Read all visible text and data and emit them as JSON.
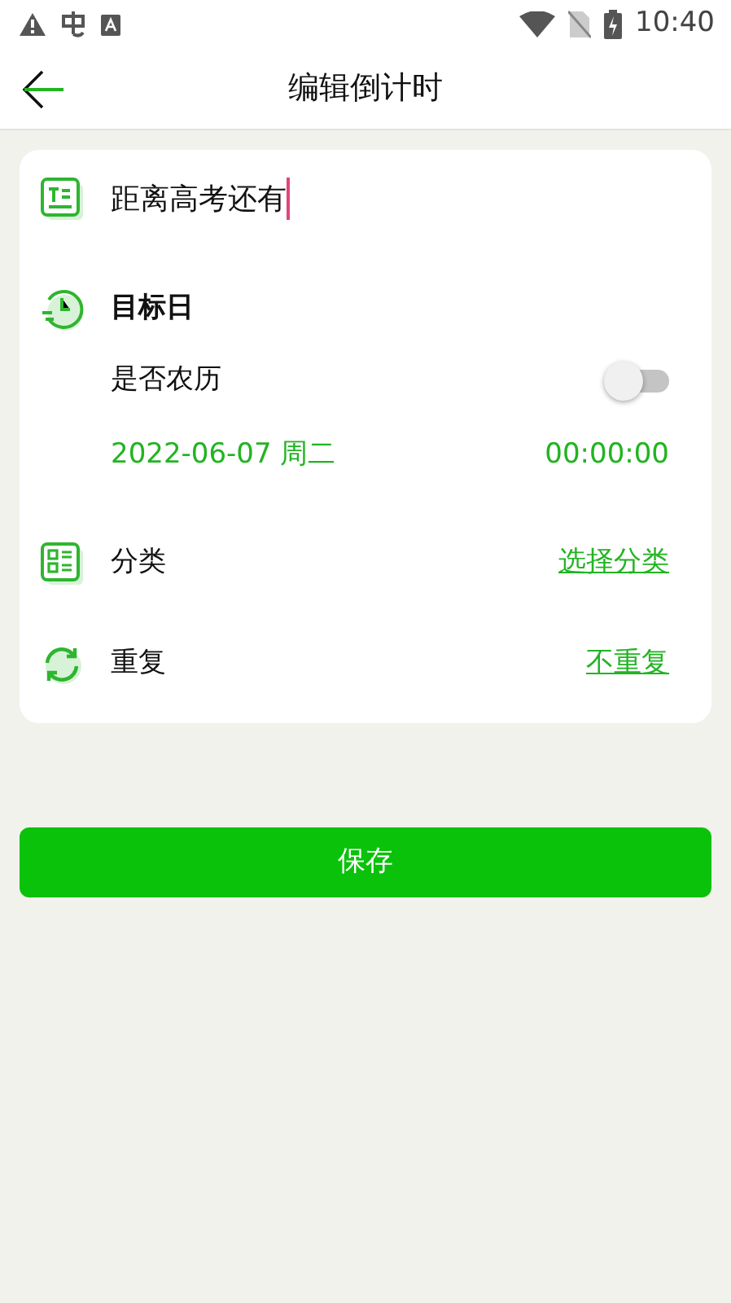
{
  "status_bar": {
    "time": "10:40"
  },
  "toolbar": {
    "title": "编辑倒计时"
  },
  "form": {
    "title_value": "距离高考还有",
    "target_label": "目标日",
    "lunar": {
      "label": "是否农历",
      "on": false
    },
    "date": "2022-06-07 周二",
    "time": "00:00:00",
    "category": {
      "label": "分类",
      "value": "选择分类"
    },
    "repeat": {
      "label": "重复",
      "value": "不重复"
    }
  },
  "save_button": "保存"
}
